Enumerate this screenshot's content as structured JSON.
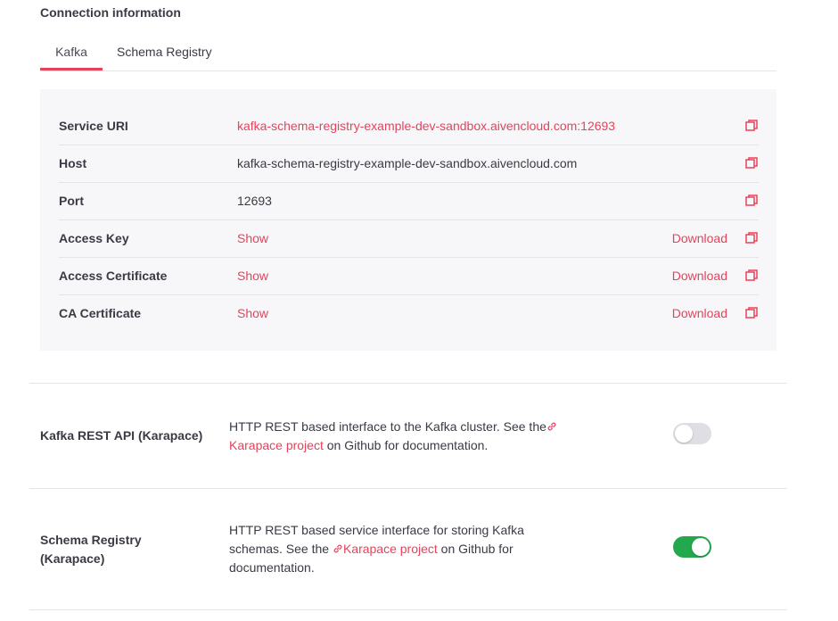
{
  "section_title": "Connection information",
  "tabs": [
    {
      "label": "Kafka",
      "active": true
    },
    {
      "label": "Schema Registry",
      "active": false
    }
  ],
  "rows": [
    {
      "label": "Service URI",
      "value": "kafka-schema-registry-example-dev-sandbox.aivencloud.com:12693",
      "link": true
    },
    {
      "label": "Host",
      "value": "kafka-schema-registry-example-dev-sandbox.aivencloud.com"
    },
    {
      "label": "Port",
      "value": "12693"
    },
    {
      "label": "Access Key",
      "show": "Show",
      "download": "Download"
    },
    {
      "label": "Access Certificate",
      "show": "Show",
      "download": "Download"
    },
    {
      "label": "CA Certificate",
      "show": "Show",
      "download": "Download"
    }
  ],
  "features": [
    {
      "name": "Kafka REST API (Karapace)",
      "desc_before": "HTTP REST based interface to the Kafka cluster. See the",
      "link_text": "Karapace project",
      "desc_after": " on Github for documentation.",
      "enabled": false
    },
    {
      "name": "Schema Registry (Karapace)",
      "desc_before": "HTTP REST based service interface for storing Kafka schemas. See the ",
      "link_text": "Karapace project",
      "desc_after": " on Github for documentation.",
      "enabled": true
    }
  ],
  "colors": {
    "accent": "#e8425a",
    "toggle_on": "#23a84d",
    "toggle_off": "#dedee4",
    "panel_bg": "#f7f7fa"
  },
  "icons": {
    "copy": "copy-icon",
    "link": "link-icon"
  }
}
